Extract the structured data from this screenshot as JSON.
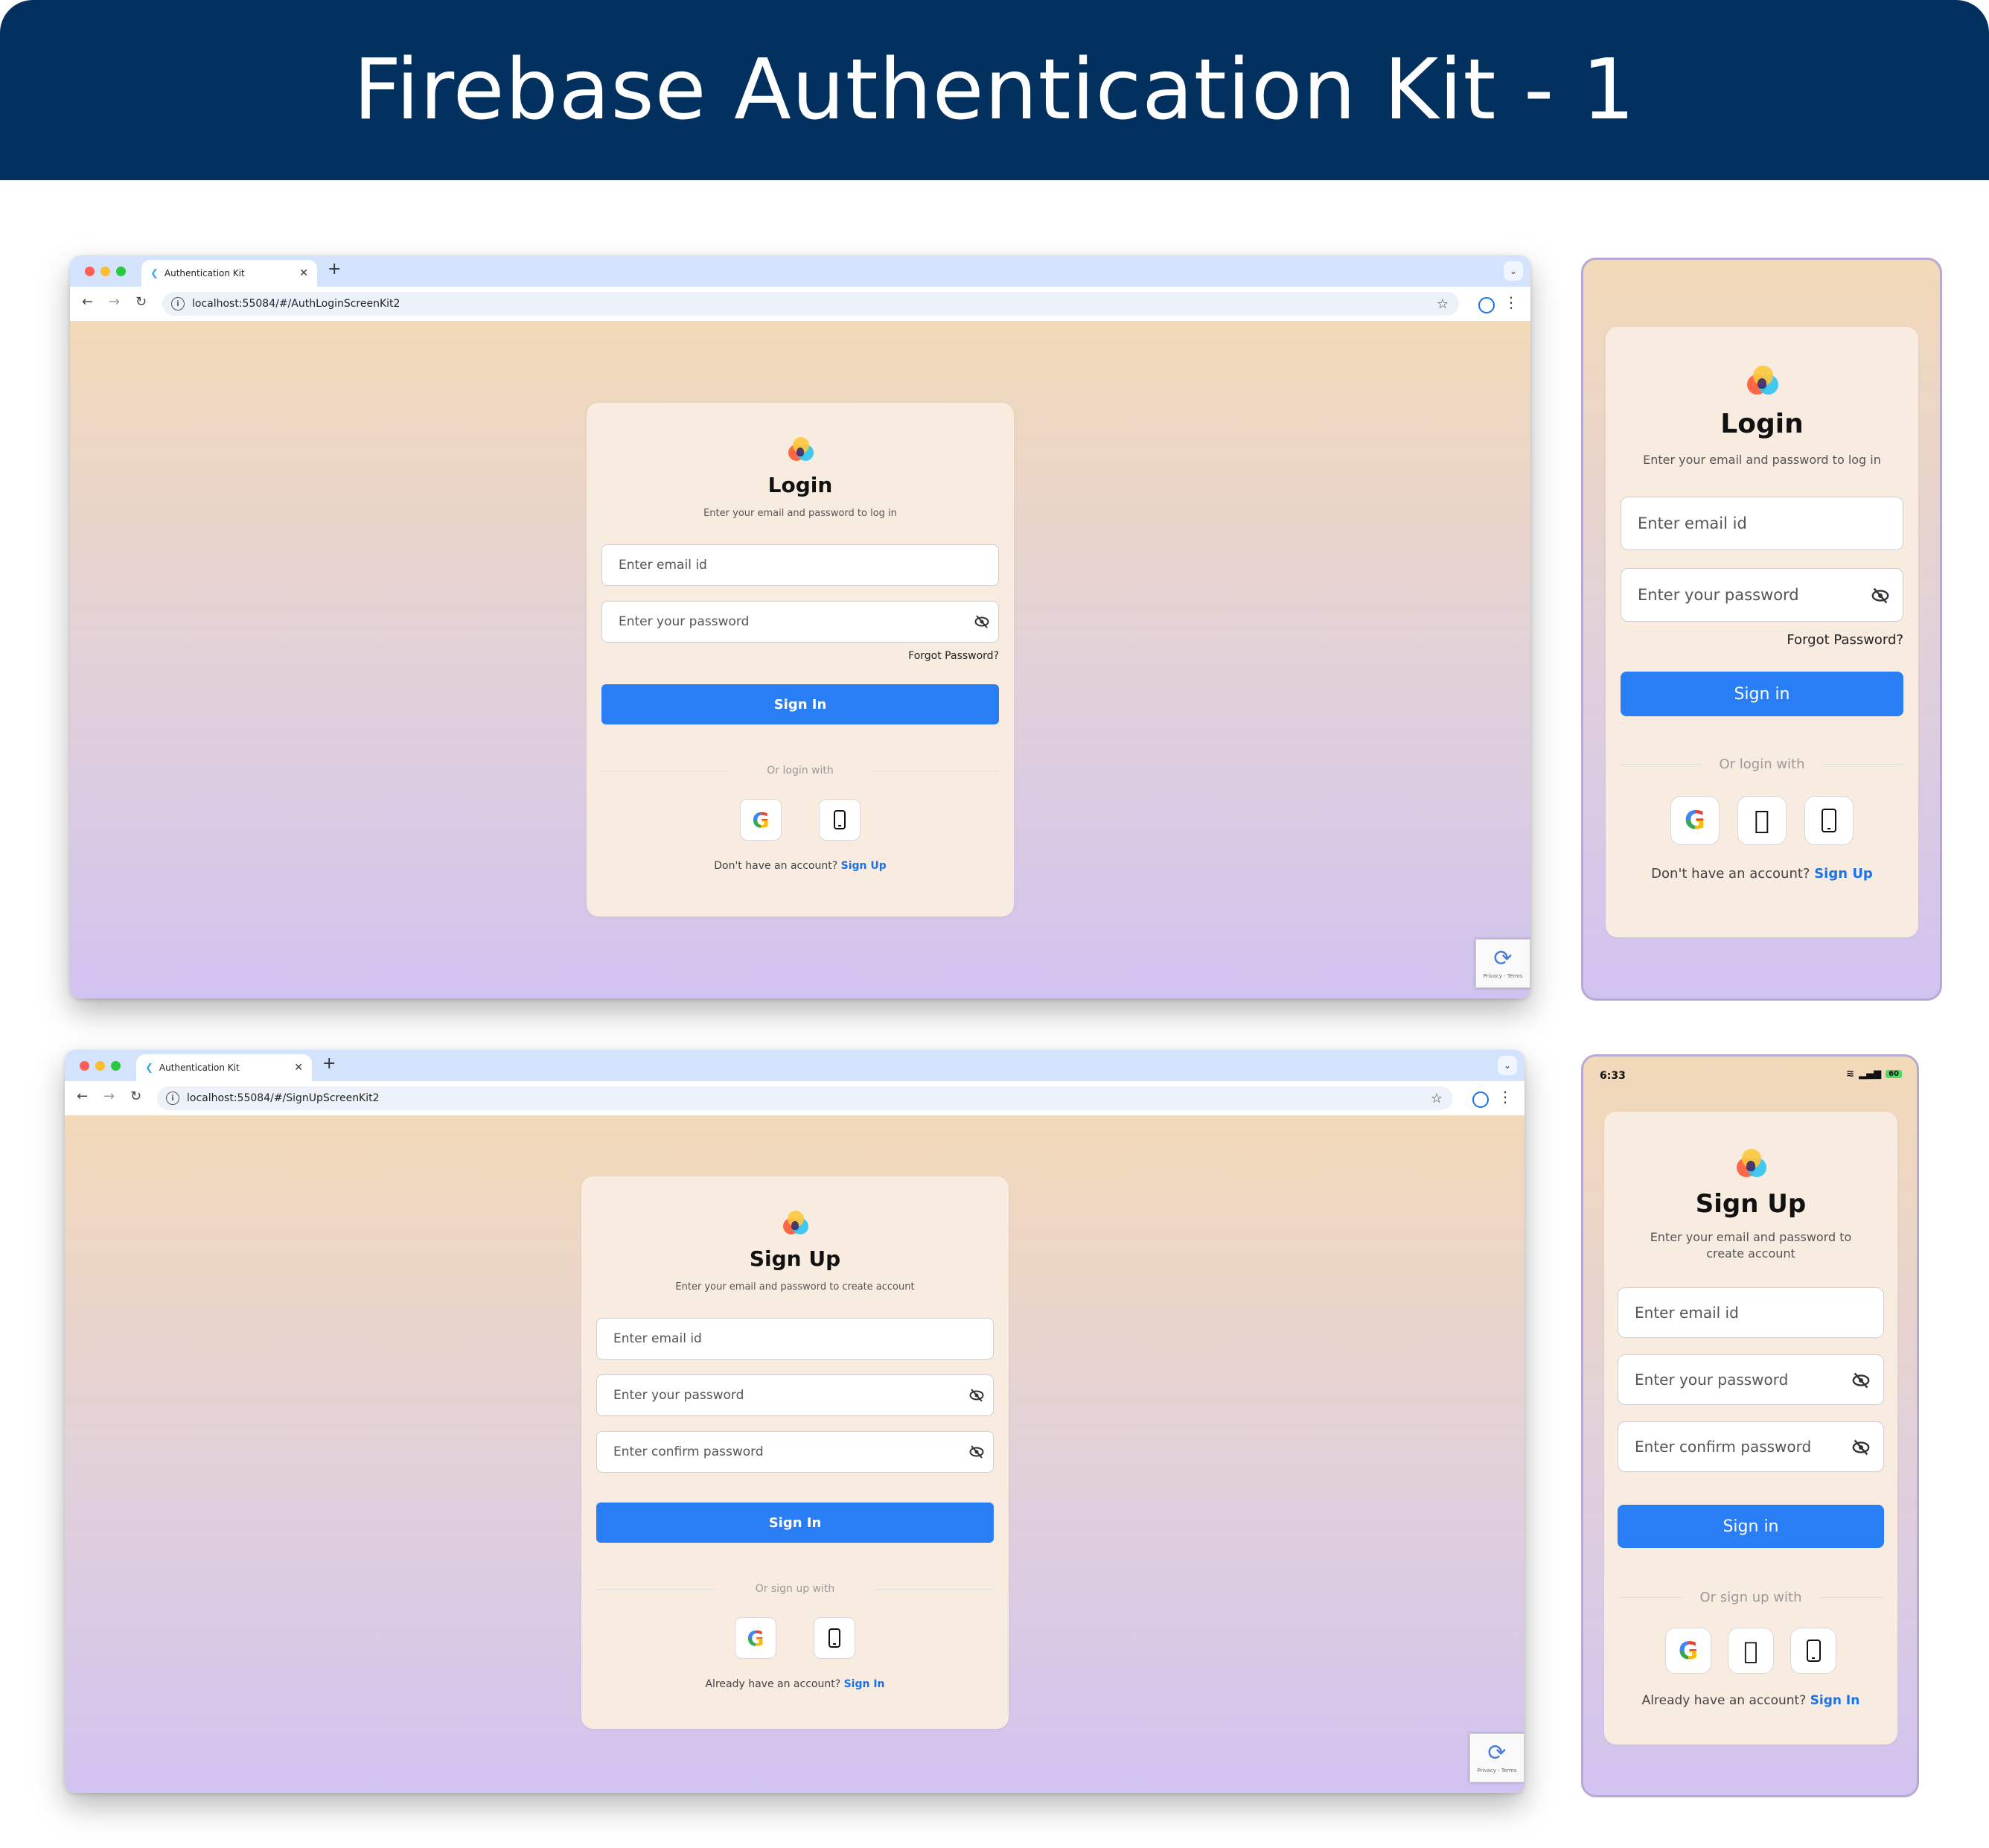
{
  "banner": {
    "title": "Firebase Authentication Kit - 1"
  },
  "colors": {
    "banner_bg": "#02305f",
    "primary_button": "#2a7ef5",
    "link": "#1a73e8",
    "card_bg": "#f8ebe0"
  },
  "browser_login": {
    "tab_title": "Authentication Kit",
    "url": "localhost:55084/#/AuthLoginScreenKit2",
    "recaptcha_text": "Privacy - Terms"
  },
  "browser_signup": {
    "tab_title": "Authentication Kit",
    "url": "localhost:55084/#/SignUpScreenKit2",
    "recaptcha_text": "Privacy - Terms"
  },
  "login_web": {
    "title": "Login",
    "subtitle": "Enter your email and password to log in",
    "email_placeholder": "Enter email id",
    "password_placeholder": "Enter your password",
    "forgot": "Forgot Password?",
    "submit": "Sign In",
    "divider": "Or login with",
    "footer_text": "Don't have an account?",
    "footer_link": "Sign Up"
  },
  "login_mobile": {
    "title": "Login",
    "subtitle": "Enter your email and password to log in",
    "email_placeholder": "Enter email id",
    "password_placeholder": "Enter your password",
    "forgot": "Forgot Password?",
    "submit": "Sign in",
    "divider": "Or login with",
    "footer_text": "Don't have an account?",
    "footer_link": "Sign Up"
  },
  "signup_web": {
    "title": "Sign Up",
    "subtitle": "Enter your email and password to create account",
    "email_placeholder": "Enter email id",
    "password_placeholder": "Enter your password",
    "confirm_placeholder": "Enter confirm password",
    "submit": "Sign In",
    "divider": "Or sign up with",
    "footer_text": "Already have an account?",
    "footer_link": "Sign In"
  },
  "signup_mobile": {
    "status_time": "6:33",
    "status_battery": "60",
    "title": "Sign Up",
    "subtitle": "Enter your email and password to create account",
    "email_placeholder": "Enter email id",
    "password_placeholder": "Enter your password",
    "confirm_placeholder": "Enter confirm password",
    "submit": "Sign in",
    "divider": "Or sign up with",
    "footer_text": "Already have an account?",
    "footer_link": "Sign In"
  },
  "icons": {
    "google": "google-icon",
    "apple": "apple-icon",
    "phone": "phone-icon",
    "eye_off": "eye-off-icon",
    "logo": "app-logo-icon"
  }
}
